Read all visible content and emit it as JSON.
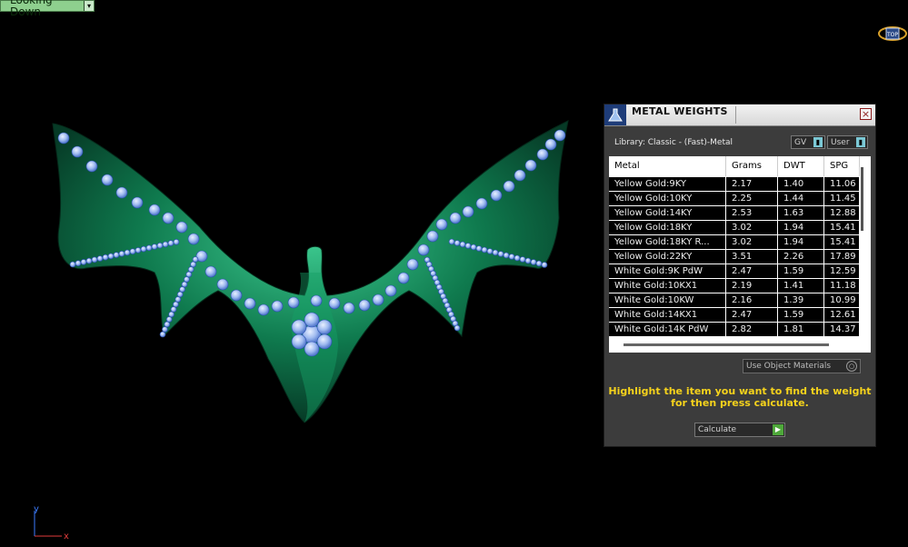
{
  "viewport": {
    "view_label": "Looking Down",
    "navcube_label": "TOP",
    "axis": {
      "y": "y",
      "x": "x"
    }
  },
  "panel": {
    "title": "METAL WEIGHTS",
    "close_glyph": "×",
    "library_label": "Library: Classic - (Fast)-Metal",
    "gv_label": "GV",
    "user_label": "User",
    "columns": [
      "Metal",
      "Grams",
      "DWT",
      "SPG"
    ],
    "rows": [
      [
        "Yellow Gold:9KY",
        "2.17",
        "1.40",
        "11.06"
      ],
      [
        "Yellow Gold:10KY",
        "2.25",
        "1.44",
        "11.45"
      ],
      [
        "Yellow Gold:14KY",
        "2.53",
        "1.63",
        "12.88"
      ],
      [
        "Yellow Gold:18KY",
        "3.02",
        "1.94",
        "15.41"
      ],
      [
        "Yellow Gold:18KY R...",
        "3.02",
        "1.94",
        "15.41"
      ],
      [
        "Yellow Gold:22KY",
        "3.51",
        "2.26",
        "17.89"
      ],
      [
        "White Gold:9K PdW",
        "2.47",
        "1.59",
        "12.59"
      ],
      [
        "White Gold:10KX1",
        "2.19",
        "1.41",
        "11.18"
      ],
      [
        "White Gold:10KW",
        "2.16",
        "1.39",
        "10.99"
      ],
      [
        "White Gold:14KX1",
        "2.47",
        "1.59",
        "12.61"
      ],
      [
        "White Gold:14K PdW",
        "2.82",
        "1.81",
        "14.37"
      ]
    ],
    "use_object_materials": "Use Object Materials",
    "instruction_line1": "Highlight the item you want to find the weight",
    "instruction_line2": "for then press calculate.",
    "calculate_label": "Calculate"
  },
  "colors": {
    "model_green": "#0f7a4e",
    "stone_blue": "#8fb4ee",
    "instruction": "#f5d21c"
  }
}
